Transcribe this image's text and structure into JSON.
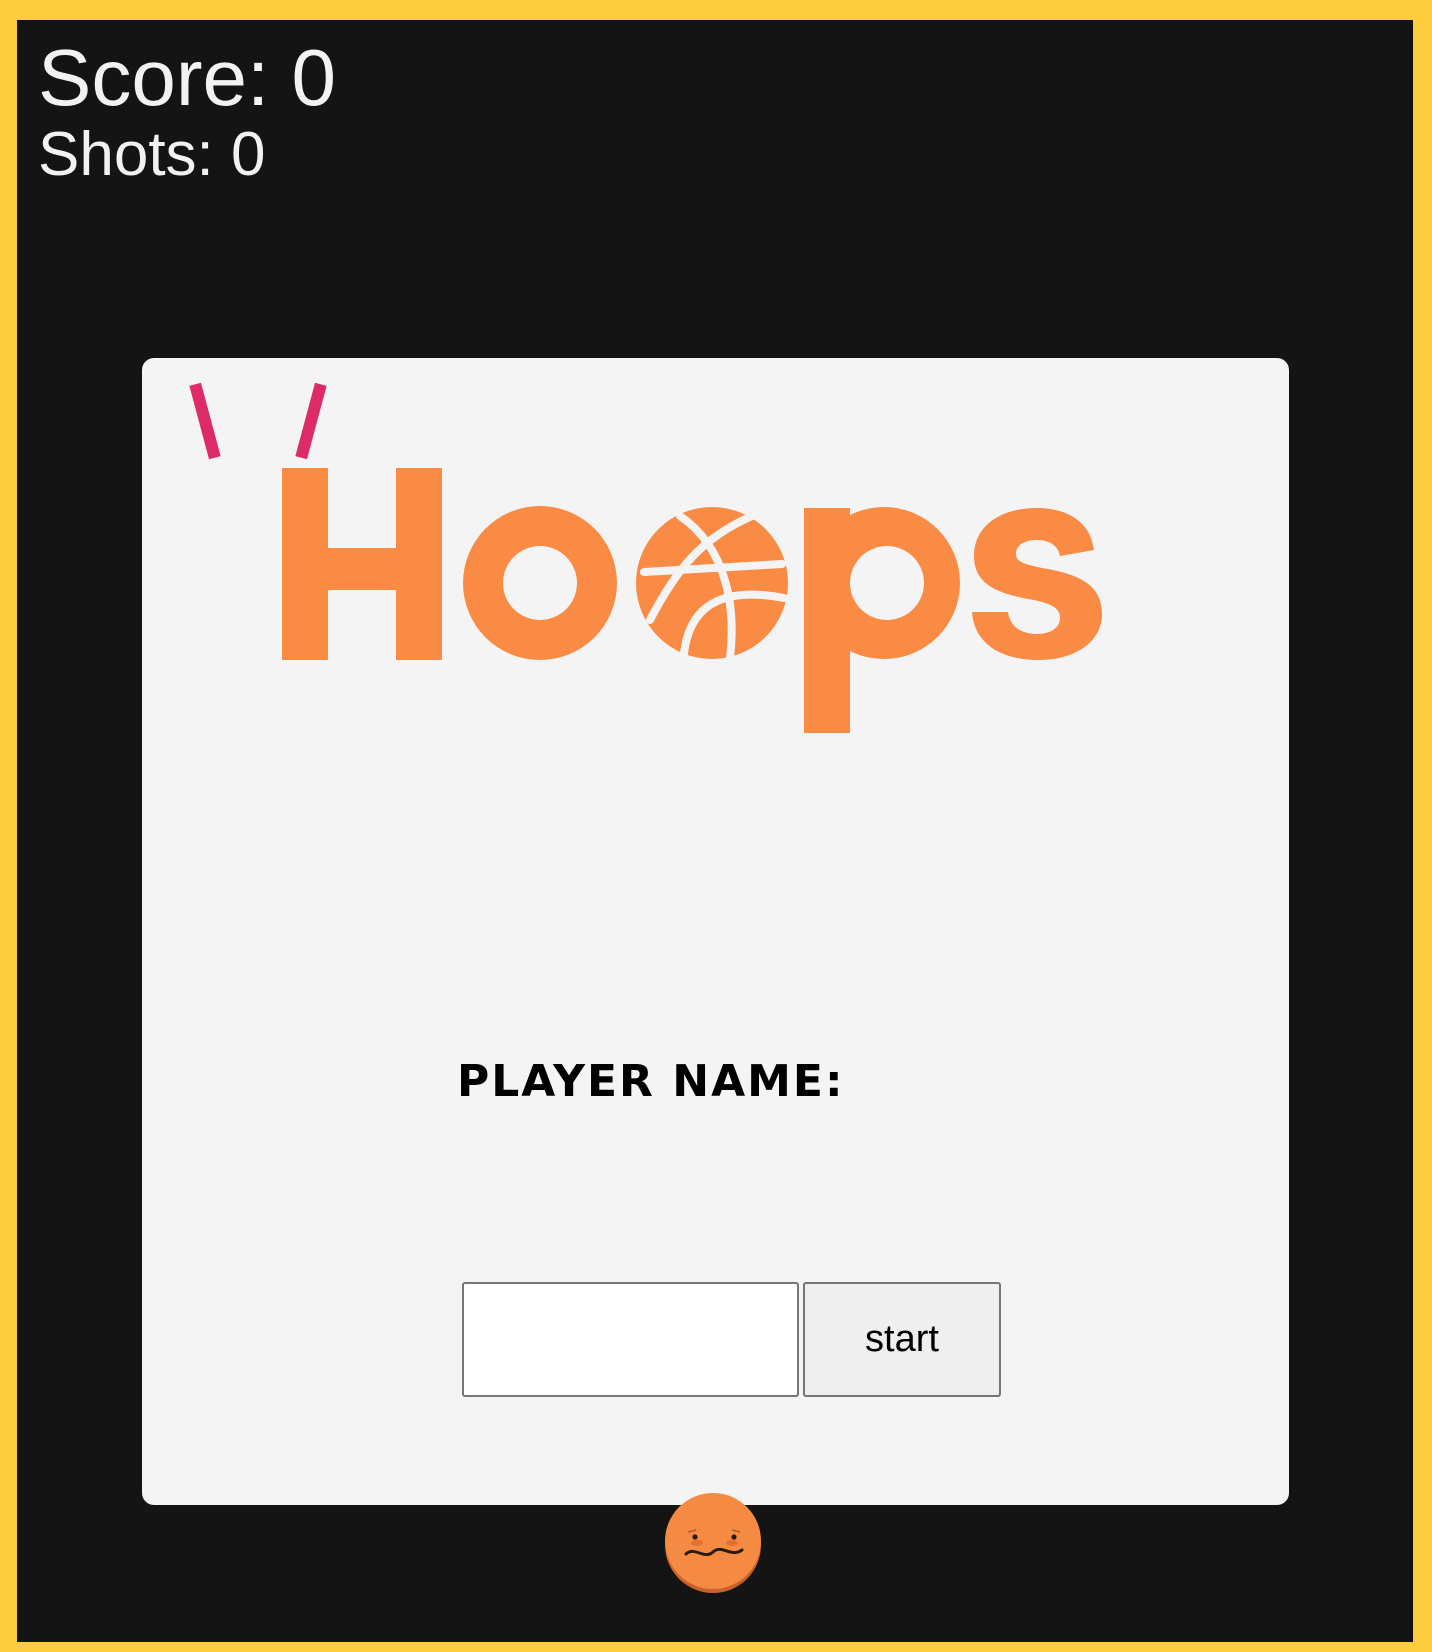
{
  "hud": {
    "score_text": "Score: 0",
    "shots_text": "Shots: 0"
  },
  "logo": {
    "wordmark": "Hoops",
    "icon": "basketball-icon"
  },
  "start_panel": {
    "player_label": "PLAYER NAME:",
    "name_input_value": "",
    "name_input_placeholder": "",
    "start_button_label": "start"
  },
  "colors": {
    "frame_border": "#fecd3d",
    "game_background": "#141414",
    "panel_background": "#f4f4f4",
    "logo_orange": "#f98b44",
    "tick_pink": "#dd2b6a",
    "ball_orange": "#f58a42"
  },
  "character": {
    "icon": "worried-basketball-face-icon"
  }
}
